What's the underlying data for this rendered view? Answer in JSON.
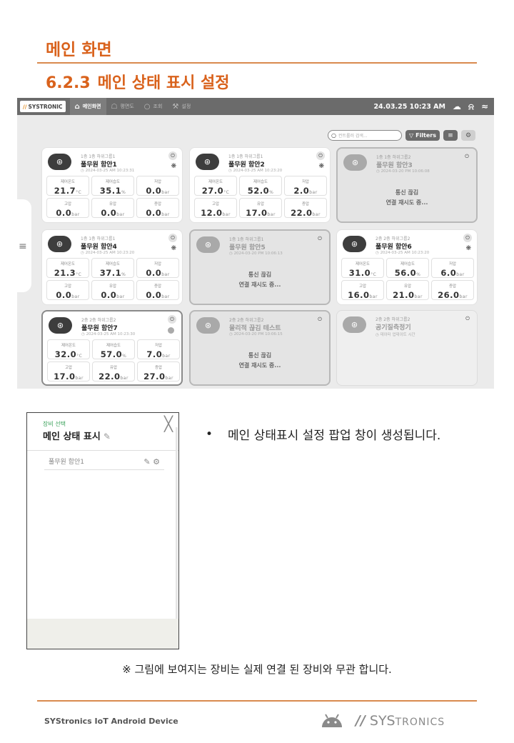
{
  "document": {
    "heading": "메인 화면",
    "subheading_number": "6.2.3",
    "subheading_title": "메인 상태 표시 설정",
    "bullet": "•",
    "bullet_text": "메인 상태표시 설정 팝업 창이 생성됩니다.",
    "note": "※ 그림에 보여지는 장비는 실제 연결 된 장비와 무관 합니다.",
    "footer_text": "SYStronics IoT Android Device",
    "footer_logo_mark": "∕∕",
    "footer_logo_big": "SYS",
    "footer_logo_small": "TRONICS"
  },
  "tablet": {
    "logo_mark": "∕∕",
    "logo_text": "SYSTRONIC",
    "nav": [
      {
        "label": "메인화면",
        "icon": "home-icon",
        "glyph": "⌂",
        "active": true
      },
      {
        "label": "평면도",
        "icon": "floorplan-icon",
        "glyph": "☖",
        "active": false
      },
      {
        "label": "조회",
        "icon": "search-icon",
        "glyph": "○",
        "active": false
      },
      {
        "label": "설정",
        "icon": "tools-icon",
        "glyph": "⚒",
        "active": false
      }
    ],
    "datetime": "24.03.25 10:23 AM",
    "weather_glyph": "☁",
    "bell_glyph": "⍾",
    "wifi_glyph": "≈",
    "search_placeholder": "컨트롤러 검색...",
    "search_glyph": "○",
    "filters_label": "Filters",
    "filters_glyph": "▽",
    "list_glyph": "≡",
    "settings_glyph": "⚙",
    "side_menu_glyph": "≡",
    "power_glyph": "⏻",
    "fan_glyph": "❋",
    "device_glyph": "⊛",
    "time_glyph": "◷",
    "cards": [
      {
        "group": "1층 1층 하위그룹1",
        "name": "풀무원 함안1",
        "time": "2024-03-25 AM 10:23:31",
        "state": "normal",
        "metrics": [
          {
            "label": "제어온도",
            "value": "21.7",
            "unit": "°C"
          },
          {
            "label": "제어습도",
            "value": "35.1",
            "unit": "%"
          },
          {
            "label": "저압",
            "value": "0.0",
            "unit": "bar"
          },
          {
            "label": "고압",
            "value": "0.0",
            "unit": "bar"
          },
          {
            "label": "유압",
            "value": "0.0",
            "unit": "bar"
          },
          {
            "label": "증압",
            "value": "0.0",
            "unit": "bar"
          }
        ]
      },
      {
        "group": "1층 1층 하위그룹1",
        "name": "풀무원 함안2",
        "time": "2024-03-25 AM 10:23:20",
        "state": "normal",
        "metrics": [
          {
            "label": "제어온도",
            "value": "27.0",
            "unit": "°C"
          },
          {
            "label": "제어습도",
            "value": "52.0",
            "unit": "%"
          },
          {
            "label": "저압",
            "value": "2.0",
            "unit": "bar"
          },
          {
            "label": "고압",
            "value": "12.0",
            "unit": "bar"
          },
          {
            "label": "유압",
            "value": "17.0",
            "unit": "bar"
          },
          {
            "label": "증압",
            "value": "22.0",
            "unit": "bar"
          }
        ]
      },
      {
        "group": "1층 1층 하위그룹2",
        "name": "풀무원 함안3",
        "time": "2024-03-20 PM 10:06:08",
        "state": "disconnected",
        "disc1": "통신 끊김",
        "disc2": "연결 재시도 중..."
      },
      {
        "group": "1층 1층 하위그룹1",
        "name": "풀무원 함안4",
        "time": "2024-03-25 AM 10:23:20",
        "state": "normal",
        "metrics": [
          {
            "label": "제어온도",
            "value": "21.3",
            "unit": "°C"
          },
          {
            "label": "제어습도",
            "value": "37.1",
            "unit": "%"
          },
          {
            "label": "저압",
            "value": "0.0",
            "unit": "bar"
          },
          {
            "label": "고압",
            "value": "0.0",
            "unit": "bar"
          },
          {
            "label": "유압",
            "value": "0.0",
            "unit": "bar"
          },
          {
            "label": "증압",
            "value": "0.0",
            "unit": "bar"
          }
        ]
      },
      {
        "group": "1층 1층 하위그룹1",
        "name": "풀무원 함안5",
        "time": "2024-03-20 PM 10:06:13",
        "state": "disconnected",
        "disc1": "통신 끊김",
        "disc2": "연결 재시도 중..."
      },
      {
        "group": "2층 2층 하위그룹2",
        "name": "풀무원 함안6",
        "time": "2024-03-25 AM 10:23:20",
        "state": "normal",
        "metrics": [
          {
            "label": "제어온도",
            "value": "31.0",
            "unit": "°C"
          },
          {
            "label": "제어습도",
            "value": "56.0",
            "unit": "%"
          },
          {
            "label": "저압",
            "value": "6.0",
            "unit": "bar"
          },
          {
            "label": "고압",
            "value": "16.0",
            "unit": "bar"
          },
          {
            "label": "유압",
            "value": "21.0",
            "unit": "bar"
          },
          {
            "label": "증압",
            "value": "26.0",
            "unit": "bar"
          }
        ]
      },
      {
        "group": "2층 2층 하위그룹2",
        "name": "풀무원 함안7",
        "time": "2024-03-25 AM 10:23:30",
        "state": "selected",
        "metrics": [
          {
            "label": "제어온도",
            "value": "32.0",
            "unit": "°C"
          },
          {
            "label": "제어습도",
            "value": "57.0",
            "unit": "%"
          },
          {
            "label": "저압",
            "value": "7.0",
            "unit": "bar"
          },
          {
            "label": "고압",
            "value": "17.0",
            "unit": "bar"
          },
          {
            "label": "유압",
            "value": "22.0",
            "unit": "bar"
          },
          {
            "label": "증압",
            "value": "27.0",
            "unit": "bar"
          }
        ]
      },
      {
        "group": "2층 2층 하위그룹2",
        "name": "물리적 끊김 테스트",
        "time": "2024-03-20 PM 10:06:15",
        "state": "disconnected",
        "disc1": "통신 끊김",
        "disc2": "연결 재시도 중..."
      },
      {
        "group": "2층 2층 하위그룹2",
        "name": "공기질측정기",
        "time": "데이터 업데이트 시간",
        "state": "blank"
      }
    ]
  },
  "popup": {
    "overline": "장비 선택",
    "title": "메인 상태 표시",
    "edit_glyph": "✎",
    "close_glyph": "╳",
    "item_label": "풀무원 함안1",
    "item_edit_glyph": "✎",
    "item_settings_glyph": "⚙"
  }
}
